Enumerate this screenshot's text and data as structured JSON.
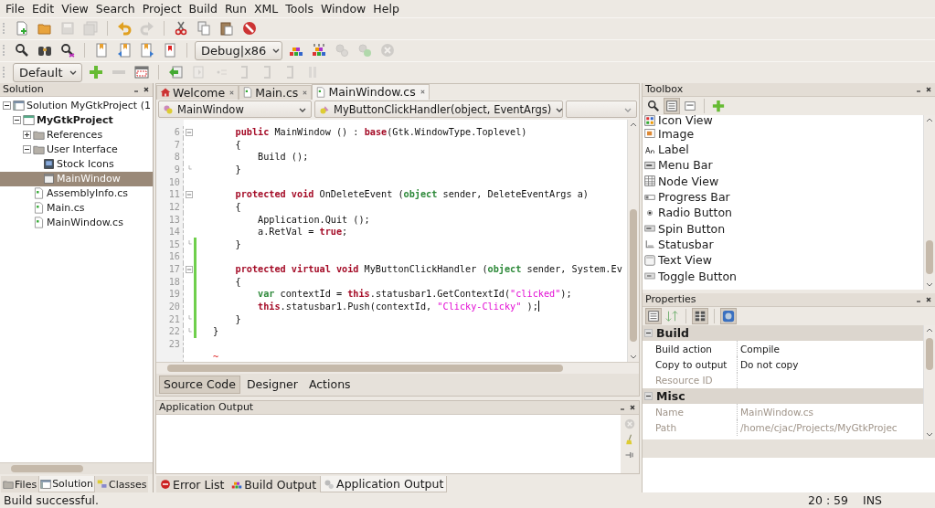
{
  "menu": [
    "File",
    "Edit",
    "View",
    "Search",
    "Project",
    "Build",
    "Run",
    "XML",
    "Tools",
    "Window",
    "Help"
  ],
  "toolbars": [
    {
      "items": [
        {
          "kind": "button",
          "disabled": false
        },
        {
          "kind": "button",
          "disabled": false
        },
        {
          "kind": "button",
          "disabled": true
        },
        {
          "kind": "button",
          "disabled": true
        },
        {
          "kind": "separator"
        },
        {
          "kind": "button",
          "disabled": false
        },
        {
          "kind": "button",
          "disabled": true
        },
        {
          "kind": "separator"
        },
        {
          "kind": "button",
          "disabled": false
        },
        {
          "kind": "button",
          "disabled": false
        },
        {
          "kind": "button",
          "disabled": false
        },
        {
          "kind": "button",
          "disabled": false
        }
      ]
    },
    {
      "items": [
        {
          "kind": "button",
          "disabled": false
        },
        {
          "kind": "button",
          "disabled": false
        },
        {
          "kind": "button",
          "disabled": false
        },
        {
          "kind": "separator"
        },
        {
          "kind": "button",
          "disabled": false
        },
        {
          "kind": "button",
          "disabled": false
        },
        {
          "kind": "button",
          "disabled": false
        },
        {
          "kind": "button",
          "disabled": false
        },
        {
          "kind": "separator"
        },
        {
          "kind": "dropdown",
          "value": "Debug|x86"
        },
        {
          "kind": "button",
          "disabled": false
        },
        {
          "kind": "button",
          "disabled": false
        },
        {
          "kind": "button",
          "disabled": true
        },
        {
          "kind": "button",
          "disabled": true
        },
        {
          "kind": "button",
          "disabled": true
        }
      ]
    },
    {
      "items": [
        {
          "kind": "dropdown",
          "value": "Default"
        },
        {
          "kind": "button",
          "disabled": false
        },
        {
          "kind": "button",
          "disabled": true
        },
        {
          "kind": "button",
          "disabled": false
        },
        {
          "kind": "separator"
        },
        {
          "kind": "button",
          "disabled": false
        },
        {
          "kind": "button",
          "disabled": true
        },
        {
          "kind": "button",
          "disabled": true
        },
        {
          "kind": "button",
          "disabled": true
        },
        {
          "kind": "button",
          "disabled": true
        },
        {
          "kind": "button",
          "disabled": true
        },
        {
          "kind": "button",
          "disabled": true
        }
      ]
    }
  ],
  "solution_panel": {
    "title": "Solution",
    "tree": [
      {
        "label": "Solution MyGtkProject (1",
        "kind": "solution",
        "expanded": true,
        "selected": false,
        "children": [
          {
            "label": "MyGtkProject",
            "kind": "project",
            "expanded": true,
            "selected": false,
            "children": [
              {
                "label": "References",
                "kind": "folder",
                "expanded": false,
                "selected": false
              },
              {
                "label": "User Interface",
                "kind": "folder",
                "expanded": true,
                "selected": false,
                "children": [
                  {
                    "label": "Stock Icons",
                    "kind": "stock",
                    "selected": false
                  },
                  {
                    "label": "MainWindow",
                    "kind": "window",
                    "selected": true
                  }
                ]
              },
              {
                "label": "AssemblyInfo.cs",
                "kind": "file",
                "selected": false
              },
              {
                "label": "Main.cs",
                "kind": "file",
                "selected": false
              },
              {
                "label": "MainWindow.cs",
                "kind": "file",
                "selected": false
              }
            ]
          }
        ]
      }
    ],
    "tabs": [
      {
        "label": "Files",
        "selected": false
      },
      {
        "label": "Solution",
        "selected": true
      },
      {
        "label": "Classes",
        "selected": false
      }
    ]
  },
  "editor": {
    "tabs": [
      {
        "label": "Welcome",
        "kind": "home",
        "selected": false
      },
      {
        "label": "Main.cs",
        "kind": "file",
        "selected": false
      },
      {
        "label": "MainWindow.cs",
        "kind": "file",
        "selected": true
      }
    ],
    "class_selector": "MainWindow",
    "member_selector": "MyButtonClickHandler(object, EventArgs)",
    "lines": [
      {
        "number": "6",
        "changed": false,
        "fold_start": true,
        "fold_end": false,
        "cursor": false,
        "segments": [
          {
            "text": "    public",
            "kind": "keyword"
          },
          {
            "text": " MainWindow () : ",
            "kind": "plain"
          },
          {
            "text": "base",
            "kind": "keyword"
          },
          {
            "text": "(Gtk.WindowType.Toplevel)",
            "kind": "plain"
          }
        ]
      },
      {
        "number": "7",
        "changed": false,
        "fold_start": false,
        "fold_end": false,
        "cursor": false,
        "segments": [
          {
            "text": "    {",
            "kind": "plain"
          }
        ]
      },
      {
        "number": "8",
        "changed": false,
        "fold_start": false,
        "fold_end": false,
        "cursor": false,
        "segments": [
          {
            "text": "        Build ();",
            "kind": "plain"
          }
        ]
      },
      {
        "number": "9",
        "changed": false,
        "fold_start": false,
        "fold_end": true,
        "cursor": false,
        "segments": [
          {
            "text": "    }",
            "kind": "plain"
          }
        ]
      },
      {
        "number": "10",
        "changed": false,
        "fold_start": false,
        "fold_end": false,
        "cursor": false
      },
      {
        "number": "11",
        "changed": false,
        "fold_start": true,
        "fold_end": false,
        "cursor": false,
        "segments": [
          {
            "text": "    protected void",
            "kind": "keyword"
          },
          {
            "text": " OnDeleteEvent (",
            "kind": "plain"
          },
          {
            "text": "object",
            "kind": "type"
          },
          {
            "text": " sender, DeleteEventArgs a)",
            "kind": "plain"
          }
        ]
      },
      {
        "number": "12",
        "changed": false,
        "fold_start": false,
        "fold_end": false,
        "cursor": false,
        "segments": [
          {
            "text": "    {",
            "kind": "plain"
          }
        ]
      },
      {
        "number": "13",
        "changed": false,
        "fold_start": false,
        "fold_end": false,
        "cursor": false,
        "segments": [
          {
            "text": "        Application.Quit ();",
            "kind": "plain"
          }
        ]
      },
      {
        "number": "14",
        "changed": false,
        "fold_start": false,
        "fold_end": false,
        "cursor": false,
        "segments": [
          {
            "text": "        a.RetVal = ",
            "kind": "plain"
          },
          {
            "text": "true",
            "kind": "keyword"
          },
          {
            "text": ";",
            "kind": "plain"
          }
        ]
      },
      {
        "number": "15",
        "changed": true,
        "fold_start": false,
        "fold_end": true,
        "cursor": false,
        "segments": [
          {
            "text": "    }",
            "kind": "plain"
          }
        ]
      },
      {
        "number": "16",
        "changed": true,
        "fold_start": false,
        "fold_end": false,
        "cursor": false
      },
      {
        "number": "17",
        "changed": true,
        "fold_start": true,
        "fold_end": false,
        "cursor": false,
        "segments": [
          {
            "text": "    protected virtual void",
            "kind": "keyword"
          },
          {
            "text": " MyButtonClickHandler (",
            "kind": "plain"
          },
          {
            "text": "object",
            "kind": "type"
          },
          {
            "text": " sender, System.Ev",
            "kind": "plain"
          }
        ]
      },
      {
        "number": "18",
        "changed": true,
        "fold_start": false,
        "fold_end": false,
        "cursor": false,
        "segments": [
          {
            "text": "    {",
            "kind": "plain"
          }
        ]
      },
      {
        "number": "19",
        "changed": true,
        "fold_start": false,
        "fold_end": false,
        "cursor": false,
        "segments": [
          {
            "text": "        var",
            "kind": "type"
          },
          {
            "text": " contextId = ",
            "kind": "plain"
          },
          {
            "text": "this",
            "kind": "keyword"
          },
          {
            "text": ".statusbar1.GetContextId(",
            "kind": "plain"
          },
          {
            "text": "\"clicked\"",
            "kind": "string"
          },
          {
            "text": ");",
            "kind": "plain"
          }
        ]
      },
      {
        "number": "20",
        "changed": true,
        "fold_start": false,
        "fold_end": false,
        "cursor": true,
        "segments": [
          {
            "text": "        this",
            "kind": "keyword"
          },
          {
            "text": ".statusbar1.Push(contextId, ",
            "kind": "plain"
          },
          {
            "text": "\"Clicky-Clicky\"",
            "kind": "string"
          },
          {
            "text": " );",
            "kind": "plain"
          }
        ]
      },
      {
        "number": "21",
        "changed": true,
        "fold_start": false,
        "fold_end": true,
        "cursor": false,
        "segments": [
          {
            "text": "    }",
            "kind": "plain"
          }
        ]
      },
      {
        "number": "22",
        "changed": true,
        "fold_start": false,
        "fold_end": true,
        "cursor": false,
        "segments": [
          {
            "text": "}",
            "kind": "plain"
          }
        ]
      },
      {
        "number": "23",
        "changed": false,
        "fold_start": false,
        "fold_end": false,
        "cursor": false
      }
    ],
    "eof_marker": "~",
    "view_tabs": [
      {
        "label": "Source Code",
        "selected": true
      },
      {
        "label": "Designer",
        "selected": false
      },
      {
        "label": "Actions",
        "selected": false
      }
    ]
  },
  "output_panel": {
    "title": "Application Output",
    "tabs": [
      {
        "label": "Error List",
        "kind": "error",
        "selected": false
      },
      {
        "label": "Build Output",
        "kind": "build",
        "selected": false
      },
      {
        "label": "Application Output",
        "kind": "app",
        "selected": true
      }
    ]
  },
  "toolbox": {
    "title": "Toolbox",
    "items": [
      "Icon View",
      "Image",
      "Label",
      "Menu Bar",
      "Node View",
      "Progress Bar",
      "Radio Button",
      "Spin Button",
      "Statusbar",
      "Text View",
      "Toggle Button"
    ]
  },
  "properties": {
    "title": "Properties",
    "categories": [
      {
        "name": "Build",
        "expanded": true,
        "rows": [
          {
            "name": "Build action",
            "value": "Compile",
            "disabled": false
          },
          {
            "name": "Copy to output",
            "value": "Do not copy",
            "disabled": false
          },
          {
            "name": "Resource ID",
            "disabled": true
          }
        ]
      },
      {
        "name": "Misc",
        "expanded": true,
        "rows": [
          {
            "name": "Name",
            "value": "MainWindow.cs",
            "disabled": true
          },
          {
            "name": "Path",
            "value": "/home/cjac/Projects/MyGtkProjec",
            "disabled": true
          }
        ]
      }
    ]
  },
  "status_bar": {
    "message": "Build successful.",
    "position": "20 : 59",
    "mode": "INS"
  }
}
